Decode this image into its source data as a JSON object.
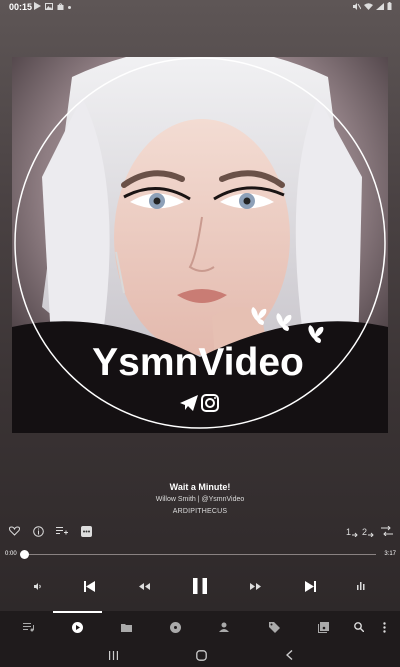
{
  "status_bar": {
    "time": "00:15",
    "left_icons": [
      "play-store-icon",
      "gallery-icon",
      "shopping-bag-icon",
      "more-dot-icon"
    ],
    "right_icons": [
      "mute-icon",
      "wifi-icon",
      "signal-icon",
      "battery-icon"
    ]
  },
  "artwork": {
    "brand_text": "YsmnVideo",
    "icons": [
      "telegram-icon",
      "instagram-icon",
      "butterfly-icon"
    ]
  },
  "track": {
    "title": "Wait a Minute!",
    "artist_line": "Willow Smith | @YsmnVideo",
    "album": "ARDIPITHECUS"
  },
  "action_row": {
    "left": [
      "heart-icon",
      "info-icon",
      "add-to-queue-icon",
      "more-menu-icon"
    ],
    "right": [
      "play-next-icon",
      "add-to-playlist-icon",
      "shuffle-icon"
    ]
  },
  "progress": {
    "current": "0:00",
    "total": "3:17",
    "fraction": 0.0
  },
  "controls": [
    "volume-icon",
    "previous-icon",
    "rewind-icon",
    "pause-icon",
    "fast-forward-icon",
    "next-icon",
    "equalizer-icon"
  ],
  "tabs": [
    "queue-icon",
    "now-playing-icon",
    "folder-icon",
    "album-icon",
    "artist-icon",
    "tag-icon",
    "playlist-icon",
    "search-icon",
    "overflow-menu-icon"
  ],
  "active_tab": "now-playing-icon",
  "nav": [
    "recents-icon",
    "home-icon",
    "back-icon"
  ],
  "colors": {
    "background_top": "#5e5656",
    "background_bottom": "#2b2627",
    "bar": "#1f1b1c",
    "accent": "#ffffff"
  }
}
